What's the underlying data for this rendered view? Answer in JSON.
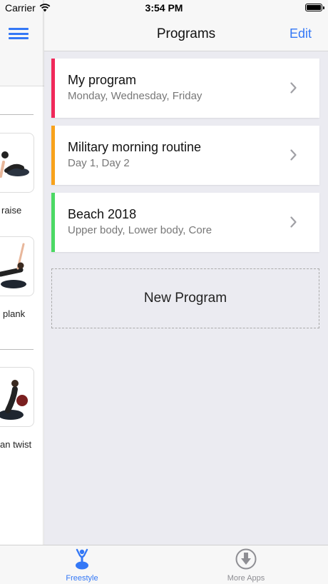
{
  "status_bar": {
    "carrier": "Carrier",
    "time": "3:54 PM"
  },
  "sidebar": {
    "exercises": [
      {
        "label": "raise"
      },
      {
        "label": "plank"
      },
      {
        "label": "an twist"
      }
    ]
  },
  "nav": {
    "title": "Programs",
    "edit_label": "Edit"
  },
  "programs": [
    {
      "title": "My program",
      "subtitle": "Monday, Wednesday, Friday",
      "color": "#f0285a"
    },
    {
      "title": "Military morning routine",
      "subtitle": "Day 1, Day 2",
      "color": "#f8a21c"
    },
    {
      "title": "Beach 2018",
      "subtitle": "Upper body, Lower body, Core",
      "color": "#4cd964"
    }
  ],
  "new_program_label": "New Program",
  "tab_bar": {
    "tabs": [
      {
        "label": "Freestyle",
        "icon": "figure-ball-icon",
        "active": true,
        "color": "#3478f6"
      },
      {
        "label": "More Apps",
        "icon": "download-circle-icon",
        "active": false,
        "color": "#8e8e93"
      }
    ]
  },
  "colors": {
    "accent": "#3478f6",
    "background": "#ebebf1"
  }
}
